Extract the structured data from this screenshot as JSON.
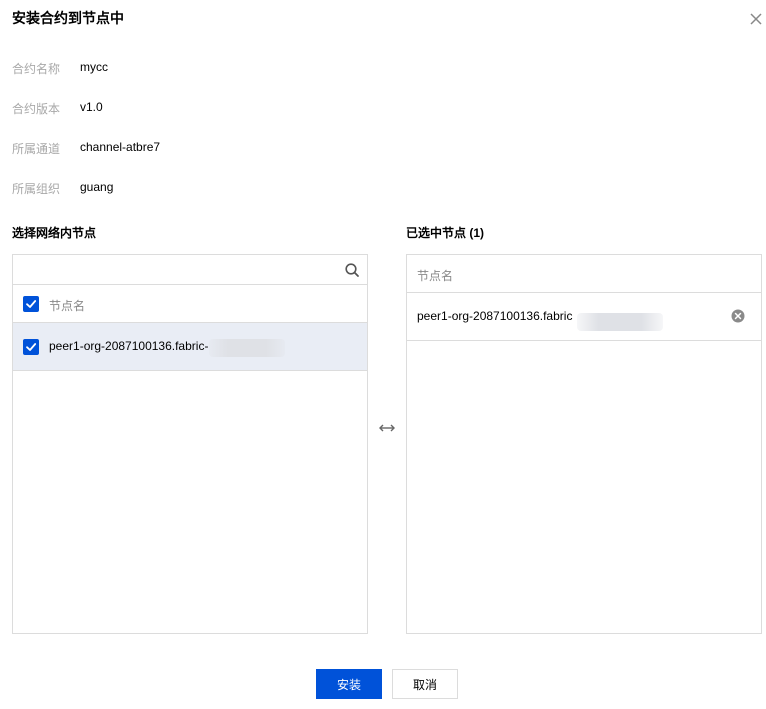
{
  "dialog": {
    "title": "安装合约到节点中"
  },
  "info": [
    {
      "label": "合约名称",
      "value": "mycc"
    },
    {
      "label": "合约版本",
      "value": "v1.0"
    },
    {
      "label": "所属通道",
      "value": "channel-atbre7"
    },
    {
      "label": "所属组织",
      "value": "guang"
    }
  ],
  "left_panel": {
    "title": "选择网络内节点",
    "search_placeholder": "",
    "header": "节点名",
    "items": [
      {
        "name": "peer1-org-2087100136.fabric-",
        "checked": true
      }
    ]
  },
  "right_panel": {
    "title": "已选中节点 (1)",
    "header": "节点名",
    "items": [
      {
        "name": "peer1-org-2087100136.fabric"
      }
    ]
  },
  "buttons": {
    "install": "安装",
    "cancel": "取消"
  },
  "colors": {
    "primary": "#0052d9",
    "selected_row": "#e9edf5",
    "border": "#dcdcdc",
    "muted_text": "#a8a8a8"
  },
  "icons": [
    "close-icon",
    "search-icon",
    "check-icon",
    "transfer-icon",
    "remove-icon"
  ]
}
